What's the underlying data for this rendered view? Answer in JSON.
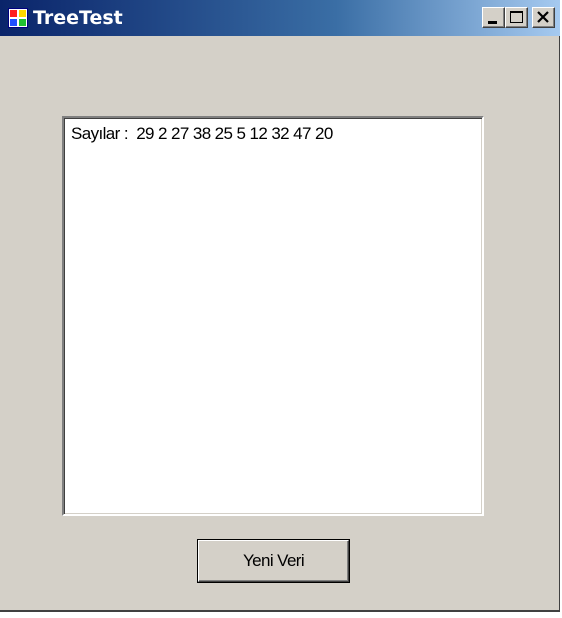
{
  "window": {
    "title": "TreeTest",
    "app_icon": "application-icon",
    "controls": {
      "minimize_icon": "minimize-icon",
      "maximize_icon": "maximize-icon",
      "close_icon": "close-icon"
    },
    "title_gradient": [
      "#0a246a",
      "#a6caf0"
    ],
    "face_color": "#d4d0c8"
  },
  "listbox": {
    "items": [
      {
        "text": "Sayılar :  29 2 27 38 25 5 12 32 47 20"
      }
    ]
  },
  "button": {
    "label": "Yeni Veri"
  }
}
